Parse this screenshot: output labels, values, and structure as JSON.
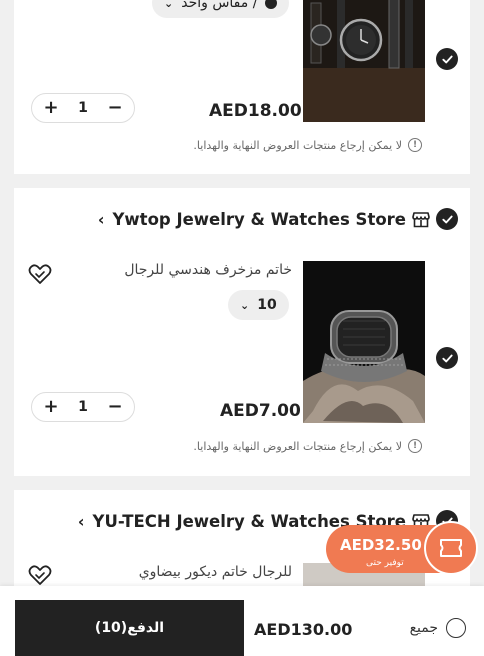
{
  "items": [
    {
      "variant": "مقاس واحد /",
      "price": "AED18.00",
      "quantity": "1",
      "plus": "+",
      "minus": "−",
      "notice": "لا يمكن إرجاع منتجات العروض النهاية والهدايا."
    }
  ],
  "stores": [
    {
      "name": "Ywtop Jewelry & Watches Store",
      "chevron": "‹",
      "product_title": "خاتم مزخرف هندسي للرجال",
      "variant": "10",
      "price": "AED7.00",
      "quantity": "1",
      "plus": "+",
      "minus": "−",
      "notice": "لا يمكن إرجاع منتجات العروض النهاية والهدايا."
    },
    {
      "name": "YU-TECH Jewelry & Watches Store",
      "chevron": "‹",
      "product_title": "للرجال خاتم ديكور بيضاوي"
    }
  ],
  "savings": {
    "amount": "AED32.50",
    "label": "توفير حتى"
  },
  "footer": {
    "pay_label": "الدفع(10)",
    "total": "AED130.00",
    "select_all": "جميع"
  },
  "colors": {
    "accent": "#f07a52",
    "dark": "#222222",
    "background": "#f0f0f0"
  },
  "icons": [
    "check-icon",
    "store-icon",
    "chevron-left-icon",
    "heart-icon",
    "info-icon",
    "coupon-icon",
    "chevron-down-icon"
  ]
}
